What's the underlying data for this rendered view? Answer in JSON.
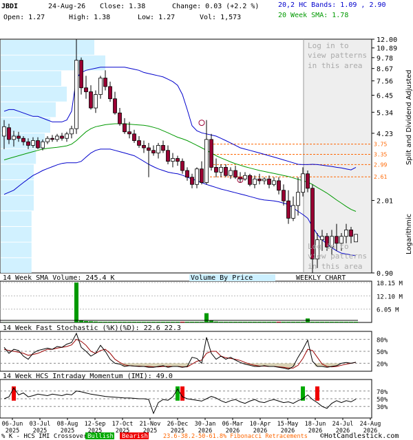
{
  "header": {
    "symbol": "JBDI",
    "date": "24-Aug-26",
    "close": "Close: 1.38",
    "change": "Change: 0.03 (+2.2 %)",
    "hc_bands": "20,2 HC Bands: 1.09 , 2.90",
    "open": "Open: 1.27",
    "high": "High: 1.38",
    "low": "Low: 1.27",
    "vol": "Vol: 1,573",
    "sma": "20 Week SMA: 1.78"
  },
  "colors": {
    "up_candle": "#ffffff",
    "down_candle": "#990033",
    "band": "#0000cc",
    "sma": "#009900",
    "vbp": "#ccf0ff",
    "fib": "#ff6600",
    "volume": "#009900",
    "volume_down": "#cc0000",
    "stoch_k": "#000000",
    "stoch_d": "#990000",
    "highlight": "#eeeeee"
  },
  "chart_data": [
    {
      "type": "candlestick",
      "scale": "log",
      "ylim": [
        0.9,
        12.0
      ],
      "y_ticks": [
        "12.00",
        "10.89",
        "9.78",
        "8.67",
        "7.56",
        "6.45",
        "5.34",
        "4.23",
        "2.01",
        "0.90"
      ],
      "right_label": "Split and Dividend Adjusted",
      "right_label_2": "Logarithmic",
      "fib_levels": [
        "3.75",
        "3.35",
        "2.99",
        "2.61"
      ],
      "fib_values": [
        3.75,
        3.35,
        2.99,
        2.61
      ],
      "overlay_texts": [
        "Log in to",
        "view patterns",
        "in this area",
        "Log in to",
        "view patterns",
        "in this area"
      ],
      "x_labels": [
        [
          "06-Jun",
          "2025"
        ],
        [
          "03-Jul",
          "2025"
        ],
        [
          "08-Aug",
          "2025"
        ],
        [
          "12-Sep",
          "2025"
        ],
        [
          "17-Oct",
          "2025"
        ],
        [
          "21-Nov",
          "2025"
        ],
        [
          "26-Dec",
          "2025"
        ],
        [
          "30-Jan",
          "2026"
        ],
        [
          "06-Mar",
          "2026"
        ],
        [
          "10-Apr",
          "2026"
        ],
        [
          "15-May",
          "2026"
        ],
        [
          "18-Jun",
          "2026"
        ],
        [
          "24-Jul",
          "2026"
        ],
        [
          "24-Aug",
          "2026"
        ]
      ],
      "candles": [
        [
          4.1,
          4.9,
          3.55,
          4.55
        ],
        [
          4.5,
          4.7,
          3.75,
          3.95
        ],
        [
          3.95,
          4.35,
          3.65,
          4.1
        ],
        [
          4.1,
          4.3,
          3.85,
          4.0
        ],
        [
          4.0,
          4.1,
          3.7,
          3.85
        ],
        [
          3.85,
          4.0,
          3.55,
          3.7
        ],
        [
          3.7,
          4.05,
          3.6,
          3.9
        ],
        [
          3.9,
          4.05,
          3.55,
          3.6
        ],
        [
          3.6,
          3.95,
          3.5,
          3.85
        ],
        [
          3.85,
          4.1,
          3.75,
          4.0
        ],
        [
          4.0,
          4.15,
          3.85,
          3.95
        ],
        [
          3.95,
          4.2,
          3.85,
          4.1
        ],
        [
          4.1,
          4.25,
          3.9,
          4.0
        ],
        [
          4.0,
          4.3,
          3.85,
          4.2
        ],
        [
          4.2,
          4.6,
          4.0,
          4.45
        ],
        [
          4.45,
          12.0,
          4.2,
          9.5
        ],
        [
          9.5,
          9.8,
          6.5,
          7.0
        ],
        [
          7.0,
          8.0,
          6.2,
          6.7
        ],
        [
          6.7,
          7.2,
          5.5,
          5.6
        ],
        [
          5.6,
          6.8,
          5.3,
          6.5
        ],
        [
          6.5,
          8.0,
          6.2,
          7.8
        ],
        [
          7.8,
          8.5,
          6.8,
          7.1
        ],
        [
          7.1,
          7.5,
          6.0,
          6.2
        ],
        [
          6.2,
          6.7,
          5.2,
          5.3
        ],
        [
          5.3,
          5.6,
          4.6,
          4.7
        ],
        [
          4.7,
          5.0,
          4.2,
          4.3
        ],
        [
          4.3,
          4.8,
          4.0,
          4.2
        ],
        [
          4.2,
          4.4,
          3.8,
          3.9
        ],
        [
          3.9,
          4.1,
          3.6,
          3.7
        ],
        [
          3.7,
          3.9,
          3.4,
          3.6
        ],
        [
          3.6,
          3.8,
          2.6,
          3.5
        ],
        [
          3.5,
          3.7,
          3.3,
          3.4
        ],
        [
          3.4,
          3.8,
          3.2,
          3.7
        ],
        [
          3.7,
          3.9,
          3.4,
          3.5
        ],
        [
          3.5,
          3.7,
          3.0,
          3.1
        ],
        [
          3.1,
          3.4,
          2.9,
          3.2
        ],
        [
          3.2,
          3.3,
          2.95,
          3.1
        ],
        [
          3.1,
          3.2,
          2.7,
          2.8
        ],
        [
          2.8,
          2.9,
          2.5,
          2.6
        ],
        [
          2.6,
          2.7,
          2.3,
          2.4
        ],
        [
          2.4,
          2.9,
          2.3,
          2.85
        ],
        [
          2.85,
          3.1,
          2.4,
          2.45
        ],
        [
          2.45,
          4.9,
          2.4,
          3.95
        ],
        [
          3.95,
          4.2,
          2.8,
          2.9
        ],
        [
          2.9,
          3.2,
          2.6,
          2.75
        ],
        [
          2.75,
          3.0,
          2.6,
          2.9
        ],
        [
          2.9,
          3.0,
          2.6,
          2.65
        ],
        [
          2.65,
          2.9,
          2.55,
          2.8
        ],
        [
          2.8,
          2.95,
          2.55,
          2.6
        ],
        [
          2.6,
          2.75,
          2.45,
          2.55
        ],
        [
          2.55,
          2.75,
          2.5,
          2.65
        ],
        [
          2.65,
          2.7,
          2.35,
          2.4
        ],
        [
          2.4,
          2.65,
          2.3,
          2.55
        ],
        [
          2.55,
          2.7,
          2.4,
          2.5
        ],
        [
          2.5,
          2.6,
          2.4,
          2.55
        ],
        [
          2.55,
          2.65,
          2.3,
          2.4
        ],
        [
          2.4,
          2.6,
          2.35,
          2.5
        ],
        [
          2.5,
          2.6,
          2.15,
          2.25
        ],
        [
          2.25,
          2.4,
          1.9,
          2.0
        ],
        [
          2.0,
          2.25,
          1.55,
          1.65
        ],
        [
          1.65,
          2.1,
          1.6,
          1.9
        ],
        [
          1.9,
          2.6,
          1.7,
          2.2
        ],
        [
          2.2,
          2.9,
          2.1,
          2.7
        ],
        [
          2.7,
          2.8,
          2.2,
          2.3
        ],
        [
          2.3,
          2.4,
          0.9,
          1.05
        ],
        [
          1.05,
          1.4,
          0.95,
          1.3
        ],
        [
          1.3,
          1.45,
          1.15,
          1.35
        ],
        [
          1.35,
          1.4,
          1.15,
          1.2
        ],
        [
          1.2,
          1.45,
          1.1,
          1.35
        ],
        [
          1.35,
          1.55,
          1.15,
          1.25
        ],
        [
          1.25,
          1.4,
          1.15,
          1.35
        ],
        [
          1.35,
          1.55,
          1.25,
          1.45
        ],
        [
          1.45,
          1.5,
          1.25,
          1.35
        ],
        [
          1.27,
          1.38,
          1.27,
          1.38
        ]
      ],
      "hc_upper": [
        5.4,
        5.5,
        5.5,
        5.4,
        5.3,
        5.2,
        5.1,
        5.1,
        5.0,
        4.9,
        4.8,
        4.8,
        4.8,
        4.9,
        5.4,
        7.8,
        8.3,
        8.5,
        8.6,
        8.7,
        8.8,
        8.8,
        8.8,
        8.8,
        8.8,
        8.8,
        8.7,
        8.6,
        8.5,
        8.3,
        8.2,
        8.1,
        8.0,
        7.9,
        7.7,
        7.5,
        7.2,
        6.5,
        5.5,
        4.6,
        4.35,
        4.25,
        4.2,
        4.15,
        4.1,
        4.0,
        3.9,
        3.8,
        3.7,
        3.6,
        3.55,
        3.5,
        3.45,
        3.4,
        3.35,
        3.3,
        3.25,
        3.2,
        3.15,
        3.1,
        3.05,
        3.0,
        2.99,
        2.99,
        3.0,
        2.99,
        2.97,
        2.95,
        2.93,
        2.9,
        2.88,
        2.85,
        2.82,
        2.9
      ],
      "hc_lower": [
        2.15,
        2.2,
        2.25,
        2.35,
        2.45,
        2.55,
        2.65,
        2.72,
        2.8,
        2.86,
        2.92,
        2.98,
        3.03,
        3.05,
        3.05,
        3.05,
        3.1,
        3.25,
        3.4,
        3.5,
        3.55,
        3.55,
        3.55,
        3.5,
        3.45,
        3.4,
        3.35,
        3.3,
        3.2,
        3.1,
        3.0,
        2.92,
        2.85,
        2.8,
        2.75,
        2.72,
        2.7,
        2.66,
        2.6,
        2.55,
        2.5,
        2.45,
        2.4,
        2.36,
        2.32,
        2.28,
        2.25,
        2.22,
        2.19,
        2.16,
        2.13,
        2.1,
        2.07,
        2.04,
        2.02,
        2.01,
        2.0,
        1.98,
        1.95,
        1.92,
        1.85,
        1.78,
        1.72,
        1.65,
        1.5,
        1.38,
        1.3,
        1.24,
        1.19,
        1.15,
        1.12,
        1.11,
        1.1,
        1.09
      ],
      "sma20": [
        3.15,
        3.2,
        3.25,
        3.3,
        3.35,
        3.4,
        3.45,
        3.5,
        3.55,
        3.58,
        3.6,
        3.62,
        3.65,
        3.68,
        3.75,
        3.9,
        4.1,
        4.3,
        4.45,
        4.55,
        4.6,
        4.65,
        4.68,
        4.7,
        4.7,
        4.7,
        4.68,
        4.66,
        4.64,
        4.62,
        4.58,
        4.52,
        4.45,
        4.35,
        4.25,
        4.15,
        4.05,
        3.98,
        3.9,
        3.8,
        3.7,
        3.6,
        3.5,
        3.4,
        3.3,
        3.22,
        3.15,
        3.08,
        3.02,
        2.97,
        2.92,
        2.88,
        2.84,
        2.8,
        2.77,
        2.74,
        2.71,
        2.68,
        2.65,
        2.62,
        2.58,
        2.54,
        2.5,
        2.46,
        2.4,
        2.32,
        2.25,
        2.18,
        2.1,
        2.02,
        1.95,
        1.88,
        1.82,
        1.78
      ],
      "vbp": [
        0.85,
        0.95,
        0.55,
        0.6,
        0.5,
        0.45,
        0.4,
        0.32,
        0.3,
        0.3,
        0.3,
        0.28,
        0.28,
        0.28,
        0.28
      ]
    },
    {
      "type": "bar",
      "label": "14 Week SMA Volume: 245.4 K",
      "center_label": "Volume By Price",
      "right_label": "WEEKLY CHART",
      "y_ticks": [
        "18.15 M",
        "12.10 M",
        "6.05 M"
      ],
      "ylim": [
        0,
        18.15
      ],
      "values_m": [
        0.05,
        0.05,
        0.05,
        0.05,
        0.05,
        0.05,
        0.05,
        0.05,
        0.05,
        0.05,
        0.05,
        0.05,
        0.05,
        0.05,
        0.05,
        18.15,
        0.9,
        0.6,
        0.5,
        0.4,
        0.3,
        0.3,
        0.3,
        0.3,
        0.3,
        0.3,
        0.3,
        0.3,
        0.3,
        0.3,
        0.3,
        0.3,
        0.3,
        0.3,
        0.3,
        0.3,
        0.3,
        0.3,
        0.3,
        0.3,
        0.3,
        0.3,
        4.2,
        0.8,
        0.4,
        0.3,
        0.3,
        0.3,
        0.3,
        0.3,
        0.3,
        0.3,
        0.3,
        0.3,
        0.3,
        0.3,
        0.3,
        0.3,
        0.3,
        0.3,
        0.3,
        0.3,
        0.3,
        1.8,
        0.3,
        0.3,
        0.3,
        0.3,
        0.3,
        0.3,
        0.3,
        0.3,
        0.3,
        0.3
      ]
    },
    {
      "type": "line",
      "label": "14 Week Fast Stochastic (%K)(%D): 22.6  22.3",
      "label_k": "(%K)",
      "label_d": "(%D)",
      "value_text": ": 22.6",
      "value_d_text": "22.3",
      "y_ticks": [
        "80%",
        "50%",
        "20%"
      ],
      "ylim": [
        0,
        100
      ],
      "k": [
        60,
        45,
        55,
        52,
        38,
        30,
        45,
        52,
        55,
        58,
        55,
        62,
        60,
        68,
        72,
        95,
        60,
        50,
        38,
        45,
        65,
        50,
        30,
        20,
        18,
        12,
        14,
        13,
        12,
        12,
        10,
        10,
        12,
        14,
        10,
        12,
        12,
        10,
        12,
        35,
        32,
        20,
        85,
        45,
        30,
        38,
        30,
        35,
        28,
        22,
        18,
        15,
        12,
        12,
        14,
        12,
        12,
        10,
        8,
        5,
        12,
        35,
        55,
        78,
        25,
        12,
        12,
        10,
        12,
        14,
        20,
        22,
        20,
        22.6
      ],
      "d": [
        55,
        52,
        50,
        48,
        45,
        40,
        42,
        45,
        50,
        55,
        55,
        58,
        60,
        62,
        66,
        80,
        75,
        65,
        50,
        45,
        52,
        55,
        45,
        30,
        22,
        16,
        14,
        13,
        13,
        12,
        12,
        11,
        11,
        12,
        12,
        12,
        12,
        11,
        11,
        18,
        25,
        28,
        45,
        50,
        50,
        38,
        34,
        32,
        30,
        27,
        22,
        18,
        15,
        13,
        13,
        12,
        12,
        11,
        10,
        8,
        8,
        15,
        32,
        55,
        52,
        35,
        18,
        12,
        11,
        12,
        15,
        18,
        20,
        22.3
      ]
    },
    {
      "type": "line",
      "label": "14 Week HCS Intraday Momentum (IMI): 49.0",
      "y_ticks": [
        "70%",
        "50%",
        "30%"
      ],
      "ylim": [
        0,
        100
      ],
      "values": [
        50,
        55,
        78,
        60,
        65,
        55,
        58,
        62,
        60,
        58,
        62,
        60,
        58,
        62,
        60,
        70,
        68,
        65,
        62,
        60,
        58,
        56,
        55,
        54,
        53,
        52,
        52,
        51,
        50,
        50,
        48,
        12,
        40,
        48,
        46,
        55,
        75,
        55,
        50,
        48,
        46,
        44,
        50,
        56,
        52,
        45,
        40,
        45,
        48,
        42,
        38,
        44,
        48,
        42,
        40,
        45,
        48,
        44,
        40,
        42,
        38,
        45,
        50,
        60,
        48,
        40,
        30,
        25,
        38,
        45,
        40,
        45,
        42,
        49
      ],
      "crossovers": [
        {
          "i": 2,
          "type": "bearish"
        },
        {
          "i": 36,
          "type": "bullish"
        },
        {
          "i": 37,
          "type": "bearish"
        },
        {
          "i": 62,
          "type": "bullish"
        },
        {
          "i": 65,
          "type": "bearish"
        }
      ]
    }
  ],
  "legend": {
    "prefix": "% K - HCS IMI Crossover:",
    "bullish": "Bullish",
    "bearish": "Bearish",
    "fib": "23.6-38.2-50-61.8% Fibonacci Retracements",
    "copyright": "©HotCandlestick.com"
  }
}
